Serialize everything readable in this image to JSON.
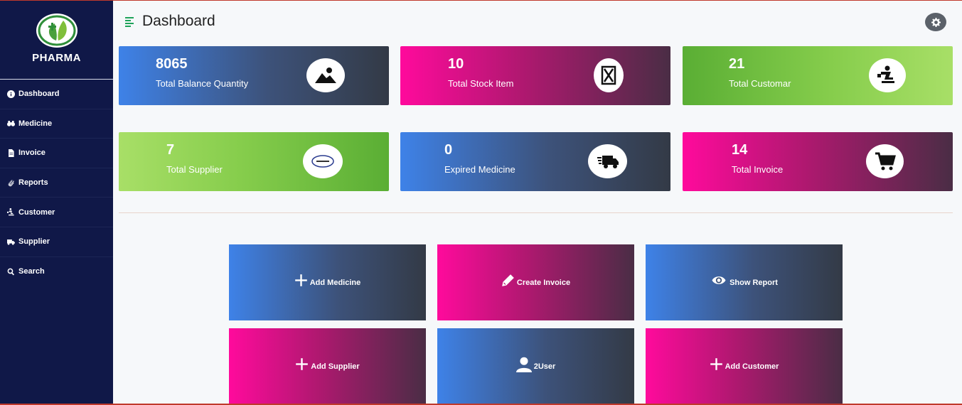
{
  "brand": {
    "name": "PHARMA"
  },
  "sidebar": {
    "items": [
      {
        "label": "Dashboard",
        "icon": "info-circle-icon"
      },
      {
        "label": "Medicine",
        "icon": "binoculars-icon"
      },
      {
        "label": "Invoice",
        "icon": "file-icon"
      },
      {
        "label": "Reports",
        "icon": "paperclip-icon"
      },
      {
        "label": "Customer",
        "icon": "person-carry-icon"
      },
      {
        "label": "Supplier",
        "icon": "truck-icon"
      },
      {
        "label": "Search",
        "icon": "search-icon"
      }
    ]
  },
  "header": {
    "title": "Dashboard"
  },
  "stats": [
    {
      "value": "8065",
      "label": "Total Balance Quantity",
      "icon": "image-icon"
    },
    {
      "value": "10",
      "label": "Total Stock Item",
      "icon": "hourglass-box-icon"
    },
    {
      "value": "21",
      "label": "Total Customar",
      "icon": "person-carry-icon"
    },
    {
      "value": "7",
      "label": "Total Supplier",
      "icon": "supplier-logo-icon"
    },
    {
      "value": "0",
      "label": "Expired Medicine",
      "icon": "truck-fast-icon"
    },
    {
      "value": "14",
      "label": "Total Invoice",
      "icon": "cart-icon"
    }
  ],
  "actions": [
    {
      "label": "Add Medicine",
      "icon": "plus-icon"
    },
    {
      "label": "Create Invoice",
      "icon": "pen-icon"
    },
    {
      "label": "Show Report",
      "icon": "eye-icon"
    },
    {
      "label": "Add Supplier",
      "icon": "plus-icon"
    },
    {
      "label": "2User",
      "icon": "user-icon"
    },
    {
      "label": "Add Customer",
      "icon": "plus-icon"
    }
  ],
  "colors": {
    "sidebar": "#101848",
    "blue_gradient_start": "#3e82e8",
    "pink_gradient_start": "#ff0a9c",
    "green_gradient": "#5aae34",
    "dark_gradient_end": "#333a46"
  }
}
